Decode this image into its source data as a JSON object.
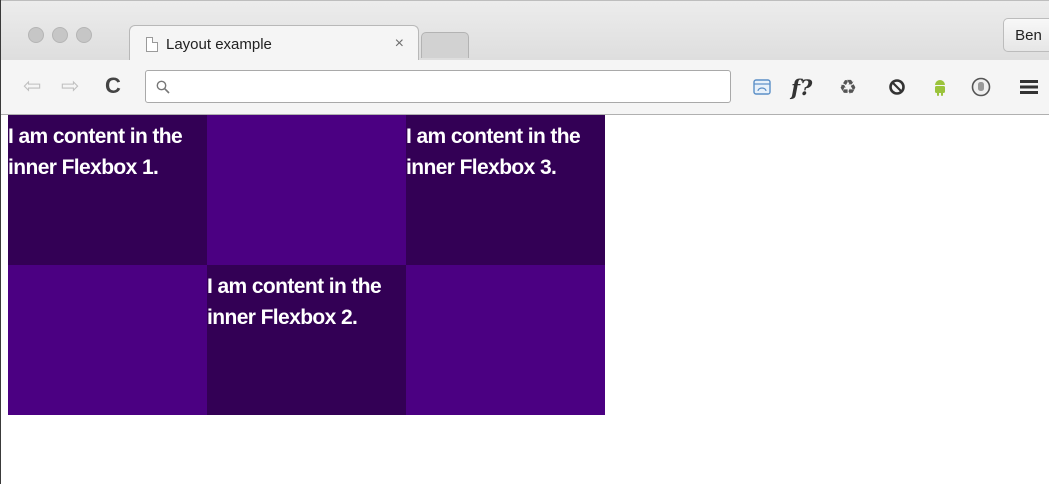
{
  "browser": {
    "tab_title": "Layout example",
    "tab_close_label": "×",
    "profile_name": "Ben",
    "omnibox_value": "",
    "extensions": [
      "screen-icon",
      "f-question-icon",
      "recycle-icon",
      "circle-arrow-icon",
      "android-icon",
      "hand-icon",
      "menu-icon"
    ],
    "f_ext_label": "f?"
  },
  "page": {
    "cells": [
      {
        "text": "I am content in the inner Flexbox 1."
      },
      {
        "text": ""
      },
      {
        "text": "I am content in the inner Flexbox 3."
      },
      {
        "text": ""
      },
      {
        "text": "I am content in the inner Flexbox 2."
      },
      {
        "text": ""
      }
    ]
  },
  "colors": {
    "dark_purple": "#330055",
    "indigo": "#4b0082",
    "android_green": "#9bc33b"
  }
}
